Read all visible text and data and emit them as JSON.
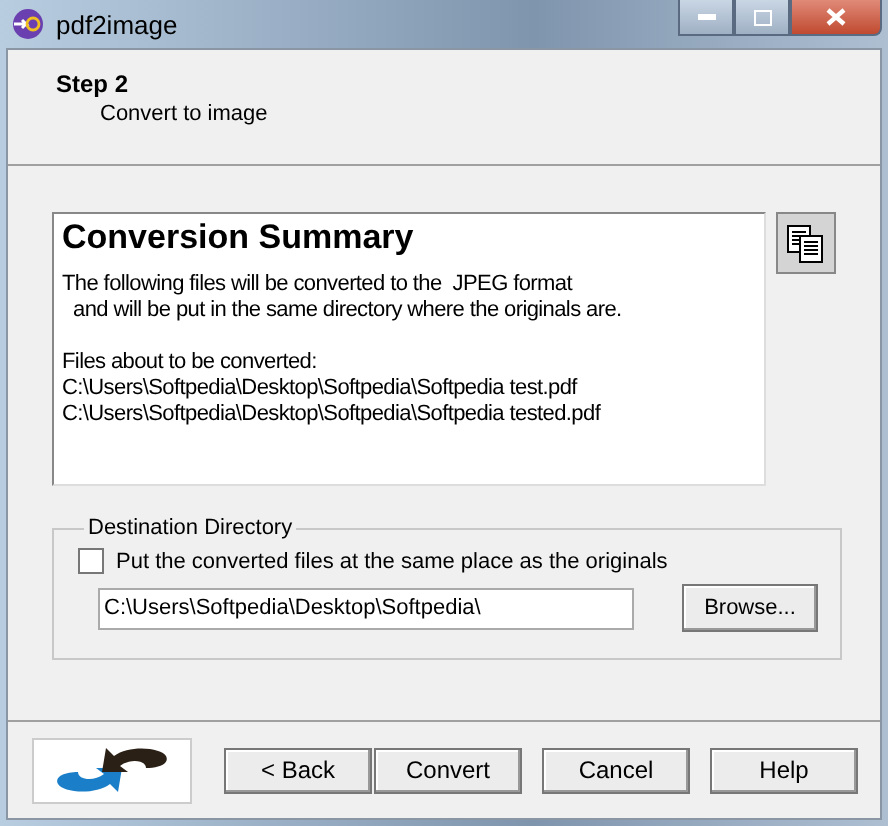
{
  "window": {
    "title": "pdf2image"
  },
  "step": {
    "title": "Step 2",
    "subtitle": "Convert to image"
  },
  "summary": {
    "heading": "Conversion Summary",
    "paragraphs": [
      [
        "The following files will be converted to the  JPEG format",
        "  and will be put in the same directory where the originals are."
      ],
      [
        "Files about to be converted:",
        "C:\\Users\\Softpedia\\Desktop\\Softpedia\\Softpedia test.pdf",
        "C:\\Users\\Softpedia\\Desktop\\Softpedia\\Softpedia tested.pdf"
      ]
    ]
  },
  "destination": {
    "legend": "Destination Directory",
    "checkbox": {
      "label": "Put the converted files at the same place as the originals",
      "checked": false
    },
    "path": "C:\\Users\\Softpedia\\Desktop\\Softpedia\\",
    "browse": "Browse..."
  },
  "buttons": [
    {
      "label": "< Back",
      "disabled": false
    },
    {
      "label": "Convert",
      "disabled": false
    },
    {
      "label": "Cancel",
      "disabled": false
    },
    {
      "label": "Help",
      "disabled": false
    }
  ]
}
